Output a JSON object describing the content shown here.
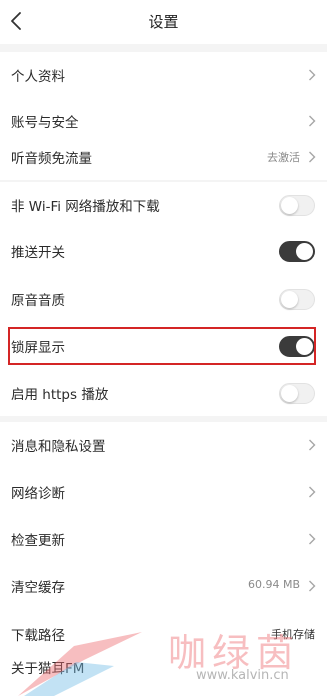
{
  "header": {
    "title": "设置",
    "back_icon": "chevron-left-icon"
  },
  "sections": {
    "account": [
      {
        "label": "个人资料"
      },
      {
        "label": "账号与安全"
      },
      {
        "label": "听音频免流量",
        "value": "去激活"
      }
    ],
    "playback": [
      {
        "label": "非 Wi-Fi 网络播放和下载",
        "toggle": false
      },
      {
        "label": "推送开关",
        "toggle": true
      },
      {
        "label": "原音音质",
        "toggle": false
      },
      {
        "label": "锁屏显示",
        "toggle": true,
        "highlighted": true
      },
      {
        "label": "启用 https 播放",
        "toggle": false
      }
    ],
    "general": [
      {
        "label": "消息和隐私设置"
      },
      {
        "label": "网络诊断"
      },
      {
        "label": "检查更新"
      },
      {
        "label": "清空缓存",
        "value": "60.94 MB"
      },
      {
        "label": "下载路径",
        "value": "手机存储"
      },
      {
        "label": "关于猫耳FM"
      }
    ]
  },
  "watermark": {
    "title": "咖绿茵",
    "url": "www.kalvin.cn"
  },
  "colors": {
    "toggle_on": "#3b3b3b",
    "toggle_off": "#f1f1f1",
    "highlight_border": "#d42525",
    "section_gap": "#f4f4f4"
  }
}
